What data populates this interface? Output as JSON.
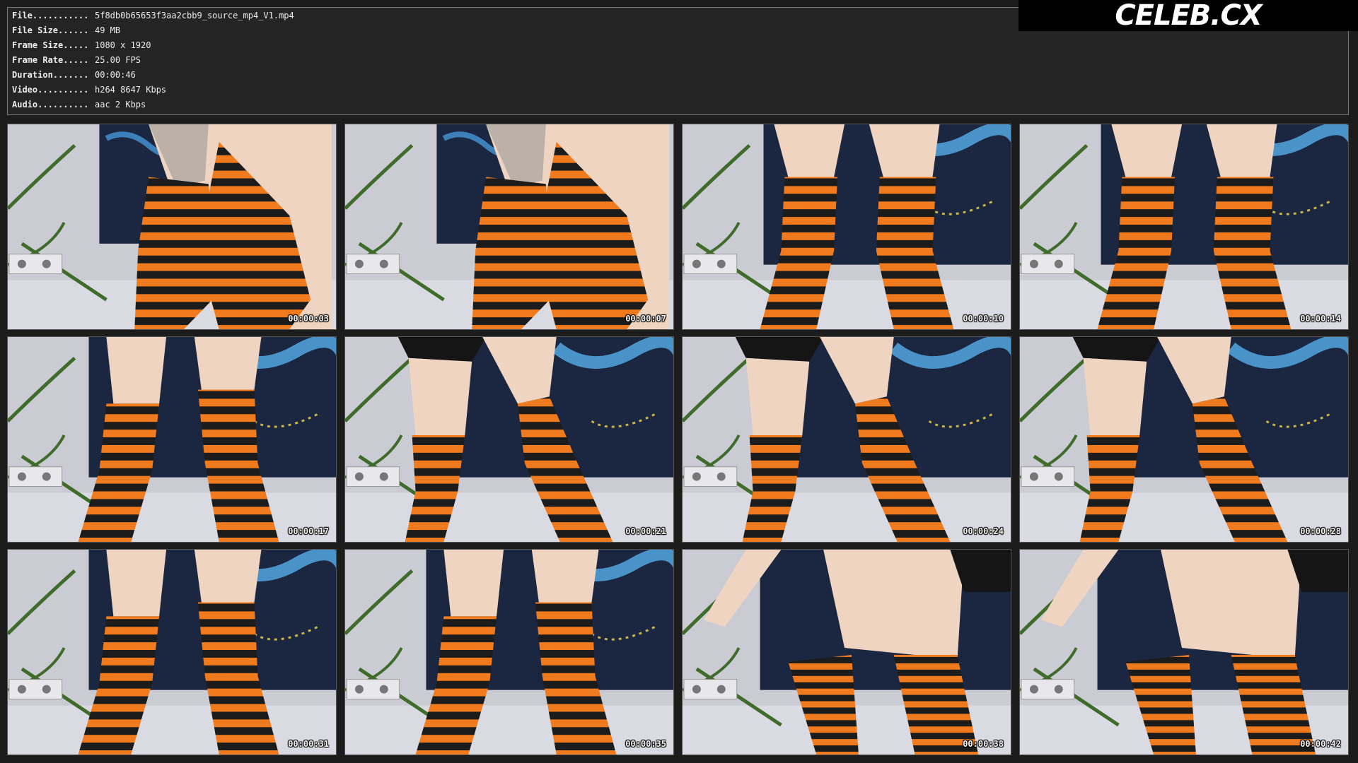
{
  "info": [
    {
      "key": "File...........",
      "value": "5f8db0b65653f3aa2cbb9_source_mp4_V1.mp4"
    },
    {
      "key": "File Size......",
      "value": "49 MB"
    },
    {
      "key": "Frame Size.....",
      "value": "1080 x 1920"
    },
    {
      "key": "Frame Rate.....",
      "value": "25.00 FPS"
    },
    {
      "key": "Duration.......",
      "value": "00:00:46"
    },
    {
      "key": "Video..........",
      "value": "h264 8647 Kbps"
    },
    {
      "key": "Audio..........",
      "value": "aac 2 Kbps"
    }
  ],
  "logo": "CELEB.CX",
  "thumbnails": [
    {
      "time": "00:00:03",
      "scene": "closeup-tattoo"
    },
    {
      "time": "00:00:07",
      "scene": "closeup-tattoo"
    },
    {
      "time": "00:00:10",
      "scene": "standing"
    },
    {
      "time": "00:00:14",
      "scene": "standing"
    },
    {
      "time": "00:00:17",
      "scene": "standing-low"
    },
    {
      "time": "00:00:21",
      "scene": "shorts"
    },
    {
      "time": "00:00:24",
      "scene": "shorts"
    },
    {
      "time": "00:00:28",
      "scene": "shorts"
    },
    {
      "time": "00:00:31",
      "scene": "standing-low"
    },
    {
      "time": "00:00:35",
      "scene": "standing-low"
    },
    {
      "time": "00:00:38",
      "scene": "crouch"
    },
    {
      "time": "00:00:42",
      "scene": "crouch"
    }
  ],
  "colors": {
    "orange": "#f07a1e",
    "stripe_dark": "#1d1c1c",
    "skin": "#efd5c1",
    "wall": "#cbcbd3",
    "painting": "#1b2640",
    "plant": "#3f6b2b"
  }
}
